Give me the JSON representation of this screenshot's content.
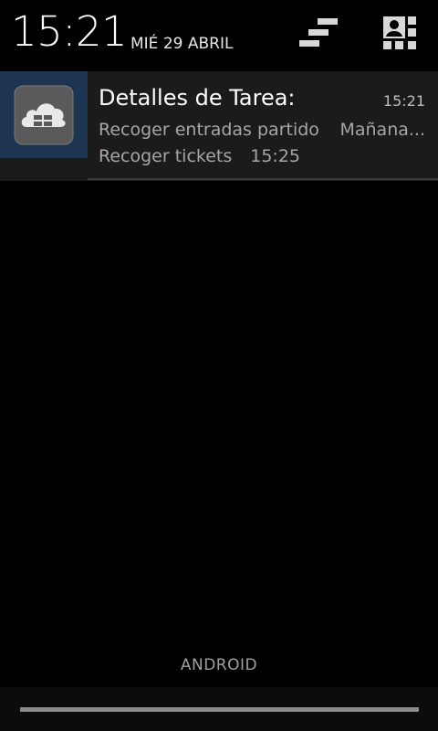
{
  "status": {
    "clock": "15:21",
    "date": "MIÉ 29 ABRIL"
  },
  "header": {
    "clear_icon": "clear-all-icon",
    "settings_icon": "quick-settings-icon"
  },
  "notification": {
    "app_icon": "cloud-app-icon",
    "title": "Detalles de Tarea:",
    "time": "15:21",
    "line1_text": "Recoger entradas partido",
    "line1_right": "Mañana...",
    "line2_text": "Recoger tickets",
    "line2_time": "15:25"
  },
  "footer": {
    "carrier": "ANDROID"
  },
  "colors": {
    "background": "#000000",
    "notification_bg": "#1b1b1b",
    "icon_bg": "#1d3550"
  }
}
